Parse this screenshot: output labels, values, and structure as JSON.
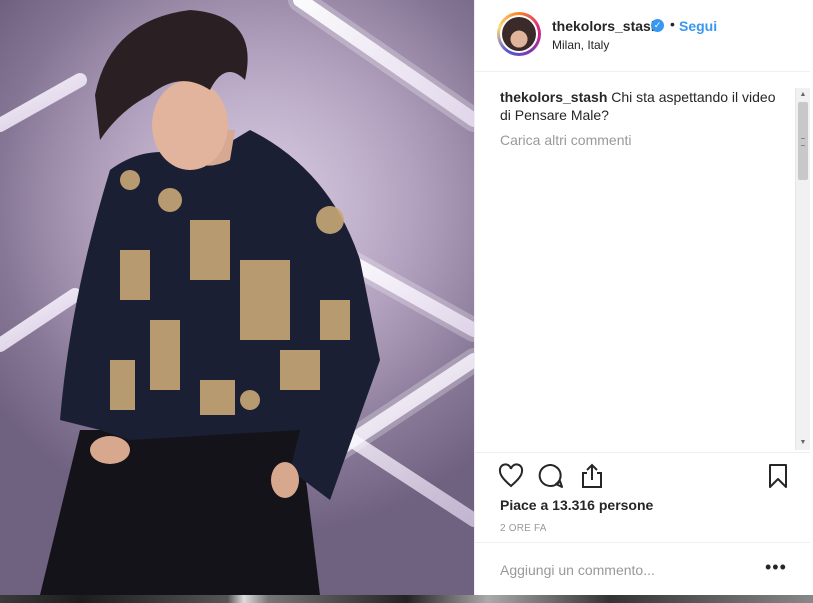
{
  "post": {
    "username": "thekolors_stash",
    "verified_icon": "verified-badge-icon",
    "separator": "•",
    "follow_label": "Segui",
    "location": "Milan, Italy"
  },
  "comments": {
    "caption_user": "thekolors_stash",
    "caption_text": "Chi sta aspettando il video di Pensare Male?",
    "load_more": "Carica altri commenti"
  },
  "actions": {
    "likes_text": "Piace a 13.316 persone",
    "time_text": "2 ORE FA"
  },
  "add_comment": {
    "placeholder": "Aggiungi un commento...",
    "more_label": "•••"
  },
  "colors": {
    "link_blue": "#3897f0",
    "text_dark": "#262626",
    "text_muted": "#999999"
  }
}
